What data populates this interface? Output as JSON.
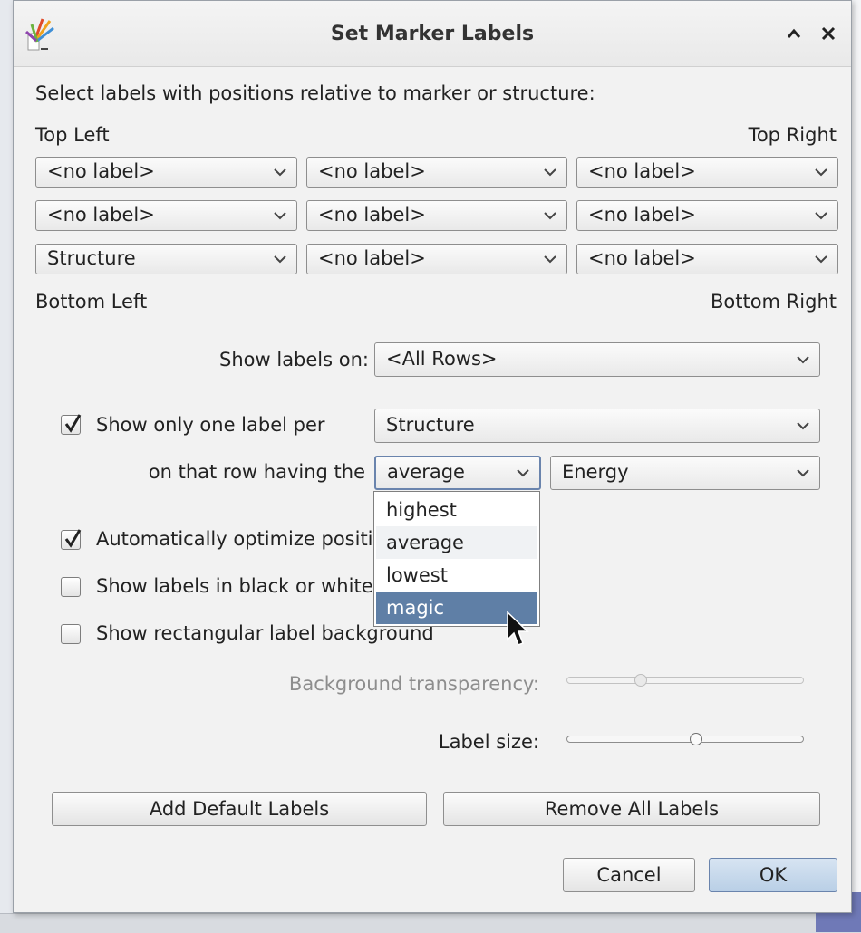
{
  "dialog": {
    "title": "Set Marker Labels",
    "minimize_icon": "caret-up-icon",
    "close_icon": "close-icon",
    "intro": "Select labels with positions relative to marker or structure:",
    "corner_labels": {
      "top_left": "Top Left",
      "top_right": "Top Right",
      "bottom_left": "Bottom Left",
      "bottom_right": "Bottom Right"
    },
    "grid": [
      [
        "<no label>",
        "<no label>",
        "<no label>"
      ],
      [
        "<no label>",
        "<no label>",
        "<no label>"
      ],
      [
        "Structure",
        "<no label>",
        "<no label>"
      ]
    ],
    "show_labels_on": {
      "label": "Show labels on:",
      "value": "<All Rows>"
    },
    "one_label": {
      "checked": true,
      "label": "Show only one label per",
      "per_value": "Structure",
      "row_having_label": "on that row having the",
      "rank_value": "average",
      "property_value": "Energy"
    },
    "rank_dropdown": {
      "options": [
        "highest",
        "average",
        "lowest",
        "magic"
      ],
      "hovered": "average",
      "selected": "magic"
    },
    "options": {
      "auto_optimize": {
        "checked": true,
        "label": "Automatically optimize positions"
      },
      "black_white": {
        "checked": false,
        "label": "Show labels in black or white"
      },
      "rect_bg": {
        "checked": false,
        "label": "Show rectangular label background"
      }
    },
    "transparency": {
      "label": "Background transparency:",
      "value": 0.3,
      "enabled": false
    },
    "label_size": {
      "label": "Label size:",
      "value": 0.55
    },
    "buttons": {
      "add_default": "Add Default Labels",
      "remove_all": "Remove All Labels",
      "cancel": "Cancel",
      "ok": "OK"
    }
  }
}
